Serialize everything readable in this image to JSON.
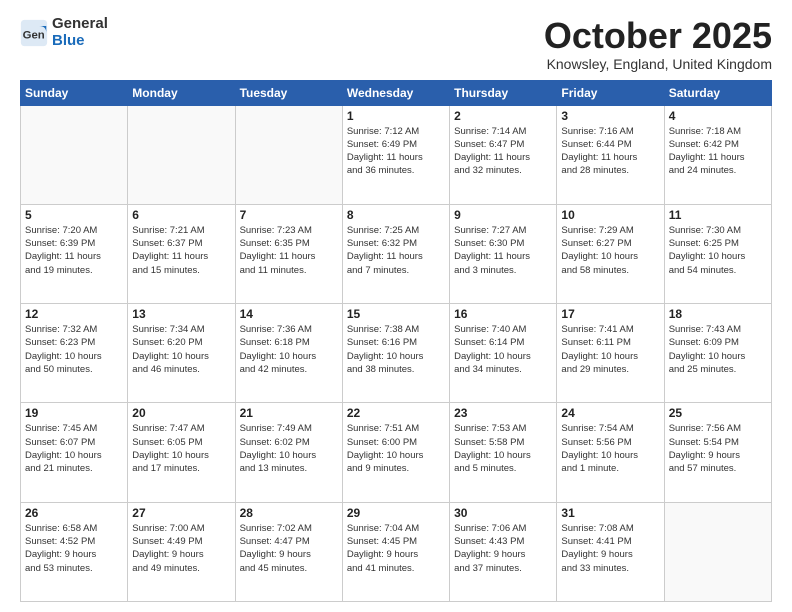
{
  "header": {
    "logo_general": "General",
    "logo_blue": "Blue",
    "month": "October 2025",
    "location": "Knowsley, England, United Kingdom"
  },
  "weekdays": [
    "Sunday",
    "Monday",
    "Tuesday",
    "Wednesday",
    "Thursday",
    "Friday",
    "Saturday"
  ],
  "weeks": [
    [
      {
        "num": "",
        "info": ""
      },
      {
        "num": "",
        "info": ""
      },
      {
        "num": "",
        "info": ""
      },
      {
        "num": "1",
        "info": "Sunrise: 7:12 AM\nSunset: 6:49 PM\nDaylight: 11 hours\nand 36 minutes."
      },
      {
        "num": "2",
        "info": "Sunrise: 7:14 AM\nSunset: 6:47 PM\nDaylight: 11 hours\nand 32 minutes."
      },
      {
        "num": "3",
        "info": "Sunrise: 7:16 AM\nSunset: 6:44 PM\nDaylight: 11 hours\nand 28 minutes."
      },
      {
        "num": "4",
        "info": "Sunrise: 7:18 AM\nSunset: 6:42 PM\nDaylight: 11 hours\nand 24 minutes."
      }
    ],
    [
      {
        "num": "5",
        "info": "Sunrise: 7:20 AM\nSunset: 6:39 PM\nDaylight: 11 hours\nand 19 minutes."
      },
      {
        "num": "6",
        "info": "Sunrise: 7:21 AM\nSunset: 6:37 PM\nDaylight: 11 hours\nand 15 minutes."
      },
      {
        "num": "7",
        "info": "Sunrise: 7:23 AM\nSunset: 6:35 PM\nDaylight: 11 hours\nand 11 minutes."
      },
      {
        "num": "8",
        "info": "Sunrise: 7:25 AM\nSunset: 6:32 PM\nDaylight: 11 hours\nand 7 minutes."
      },
      {
        "num": "9",
        "info": "Sunrise: 7:27 AM\nSunset: 6:30 PM\nDaylight: 11 hours\nand 3 minutes."
      },
      {
        "num": "10",
        "info": "Sunrise: 7:29 AM\nSunset: 6:27 PM\nDaylight: 10 hours\nand 58 minutes."
      },
      {
        "num": "11",
        "info": "Sunrise: 7:30 AM\nSunset: 6:25 PM\nDaylight: 10 hours\nand 54 minutes."
      }
    ],
    [
      {
        "num": "12",
        "info": "Sunrise: 7:32 AM\nSunset: 6:23 PM\nDaylight: 10 hours\nand 50 minutes."
      },
      {
        "num": "13",
        "info": "Sunrise: 7:34 AM\nSunset: 6:20 PM\nDaylight: 10 hours\nand 46 minutes."
      },
      {
        "num": "14",
        "info": "Sunrise: 7:36 AM\nSunset: 6:18 PM\nDaylight: 10 hours\nand 42 minutes."
      },
      {
        "num": "15",
        "info": "Sunrise: 7:38 AM\nSunset: 6:16 PM\nDaylight: 10 hours\nand 38 minutes."
      },
      {
        "num": "16",
        "info": "Sunrise: 7:40 AM\nSunset: 6:14 PM\nDaylight: 10 hours\nand 34 minutes."
      },
      {
        "num": "17",
        "info": "Sunrise: 7:41 AM\nSunset: 6:11 PM\nDaylight: 10 hours\nand 29 minutes."
      },
      {
        "num": "18",
        "info": "Sunrise: 7:43 AM\nSunset: 6:09 PM\nDaylight: 10 hours\nand 25 minutes."
      }
    ],
    [
      {
        "num": "19",
        "info": "Sunrise: 7:45 AM\nSunset: 6:07 PM\nDaylight: 10 hours\nand 21 minutes."
      },
      {
        "num": "20",
        "info": "Sunrise: 7:47 AM\nSunset: 6:05 PM\nDaylight: 10 hours\nand 17 minutes."
      },
      {
        "num": "21",
        "info": "Sunrise: 7:49 AM\nSunset: 6:02 PM\nDaylight: 10 hours\nand 13 minutes."
      },
      {
        "num": "22",
        "info": "Sunrise: 7:51 AM\nSunset: 6:00 PM\nDaylight: 10 hours\nand 9 minutes."
      },
      {
        "num": "23",
        "info": "Sunrise: 7:53 AM\nSunset: 5:58 PM\nDaylight: 10 hours\nand 5 minutes."
      },
      {
        "num": "24",
        "info": "Sunrise: 7:54 AM\nSunset: 5:56 PM\nDaylight: 10 hours\nand 1 minute."
      },
      {
        "num": "25",
        "info": "Sunrise: 7:56 AM\nSunset: 5:54 PM\nDaylight: 9 hours\nand 57 minutes."
      }
    ],
    [
      {
        "num": "26",
        "info": "Sunrise: 6:58 AM\nSunset: 4:52 PM\nDaylight: 9 hours\nand 53 minutes."
      },
      {
        "num": "27",
        "info": "Sunrise: 7:00 AM\nSunset: 4:49 PM\nDaylight: 9 hours\nand 49 minutes."
      },
      {
        "num": "28",
        "info": "Sunrise: 7:02 AM\nSunset: 4:47 PM\nDaylight: 9 hours\nand 45 minutes."
      },
      {
        "num": "29",
        "info": "Sunrise: 7:04 AM\nSunset: 4:45 PM\nDaylight: 9 hours\nand 41 minutes."
      },
      {
        "num": "30",
        "info": "Sunrise: 7:06 AM\nSunset: 4:43 PM\nDaylight: 9 hours\nand 37 minutes."
      },
      {
        "num": "31",
        "info": "Sunrise: 7:08 AM\nSunset: 4:41 PM\nDaylight: 9 hours\nand 33 minutes."
      },
      {
        "num": "",
        "info": ""
      }
    ]
  ]
}
